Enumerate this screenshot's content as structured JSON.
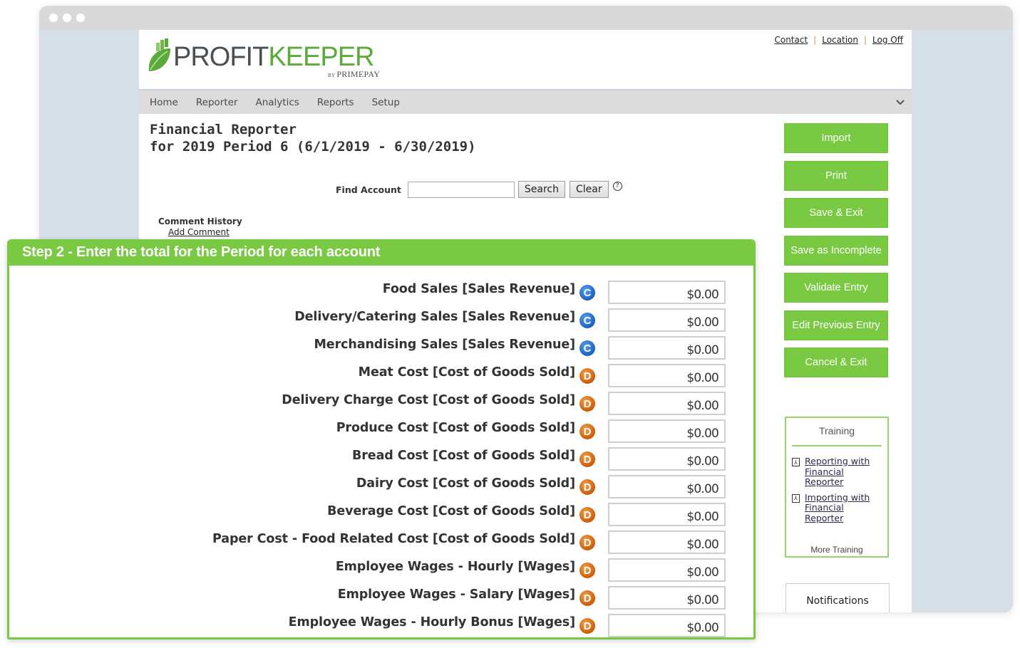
{
  "brand": {
    "name_part1": "PROFIT",
    "name_part2": "KEEPER",
    "byline_prefix": "BY",
    "byline": "PRIMEPAY"
  },
  "top_links": [
    "Contact",
    "Location",
    "Log Off"
  ],
  "nav": {
    "items": [
      "Home",
      "Reporter",
      "Analytics",
      "Reports",
      "Setup"
    ]
  },
  "page": {
    "title_line1": "Financial Reporter",
    "title_line2": "for 2019 Period 6 (6/1/2019 - 6/30/2019)"
  },
  "find_account": {
    "label": "Find Account",
    "value": "",
    "search_label": "Search",
    "clear_label": "Clear",
    "help_glyph": "?"
  },
  "comments": {
    "history_label": "Comment History",
    "add_label": "Add Comment"
  },
  "actions": [
    "Import",
    "Print",
    "Save & Exit",
    "Save as Incomplete",
    "Validate Entry",
    "Edit Previous Entry",
    "Cancel & Exit"
  ],
  "training": {
    "title": "Training",
    "links": [
      "Reporting with Financial Reporter",
      "Importing with Financial Reporter"
    ],
    "more_label": "More Training"
  },
  "notifications_label": "Notifications",
  "step": {
    "title": "Step 2 - Enter the total for the Period for each account",
    "accounts": [
      {
        "label": "Food Sales [Sales Revenue]",
        "type": "C",
        "value": "$0.00"
      },
      {
        "label": "Delivery/Catering Sales [Sales Revenue]",
        "type": "C",
        "value": "$0.00"
      },
      {
        "label": "Merchandising Sales [Sales Revenue]",
        "type": "C",
        "value": "$0.00"
      },
      {
        "label": "Meat Cost [Cost of Goods Sold]",
        "type": "D",
        "value": "$0.00"
      },
      {
        "label": "Delivery Charge Cost [Cost of Goods Sold]",
        "type": "D",
        "value": "$0.00"
      },
      {
        "label": "Produce Cost [Cost of Goods Sold]",
        "type": "D",
        "value": "$0.00"
      },
      {
        "label": "Bread Cost [Cost of Goods Sold]",
        "type": "D",
        "value": "$0.00"
      },
      {
        "label": "Dairy Cost [Cost of Goods Sold]",
        "type": "D",
        "value": "$0.00"
      },
      {
        "label": "Beverage Cost [Cost of Goods Sold]",
        "type": "D",
        "value": "$0.00"
      },
      {
        "label": "Paper Cost - Food Related Cost [Cost of Goods Sold]",
        "type": "D",
        "value": "$0.00"
      },
      {
        "label": "Employee Wages - Hourly [Wages]",
        "type": "D",
        "value": "$0.00"
      },
      {
        "label": "Employee Wages - Salary [Wages]",
        "type": "D",
        "value": "$0.00"
      },
      {
        "label": "Employee Wages - Hourly Bonus [Wages]",
        "type": "D",
        "value": "$0.00"
      }
    ]
  },
  "colors": {
    "accent_green": "#7ac943",
    "credit_badge": "#1b5fc2",
    "debit_badge": "#cc5a08"
  }
}
